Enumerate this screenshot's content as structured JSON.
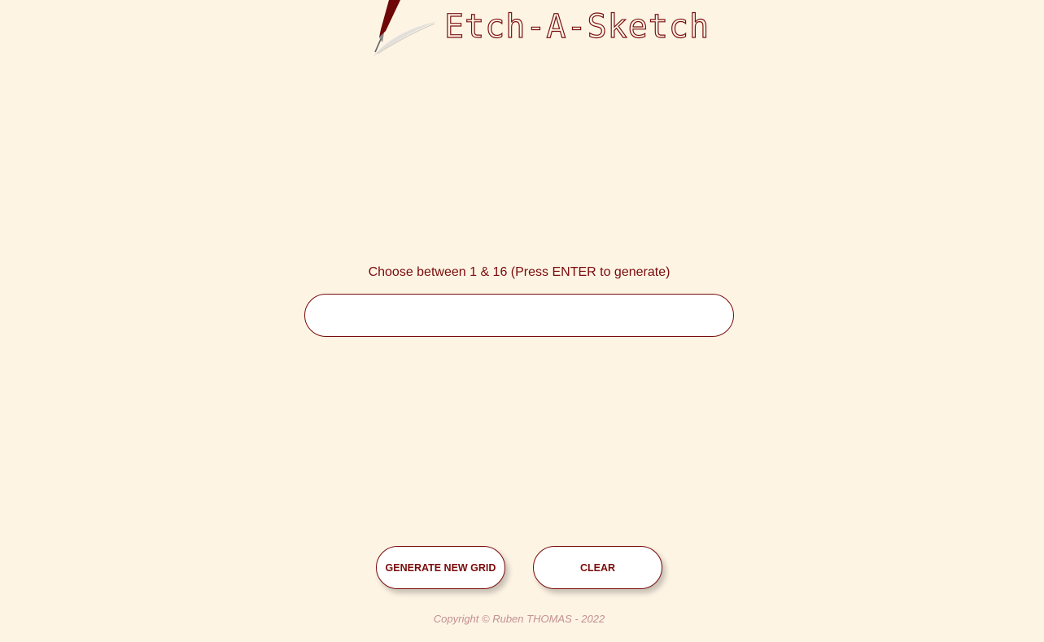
{
  "header": {
    "logo_icon": "quill-pen-icon",
    "title": "Etch-A-Sketch"
  },
  "main": {
    "prompt": "Choose between 1 & 16 (Press ENTER to generate)",
    "grid_size_input": {
      "value": "",
      "placeholder": ""
    }
  },
  "controls": {
    "generate_label": "GENERATE NEW GRID",
    "clear_label": "CLEAR"
  },
  "footer": {
    "copyright": "Copyright © Ruben THOMAS - 2022"
  },
  "colors": {
    "background": "#fdf4e4",
    "accent": "#7a0b0b",
    "footer_text": "#c49090"
  }
}
